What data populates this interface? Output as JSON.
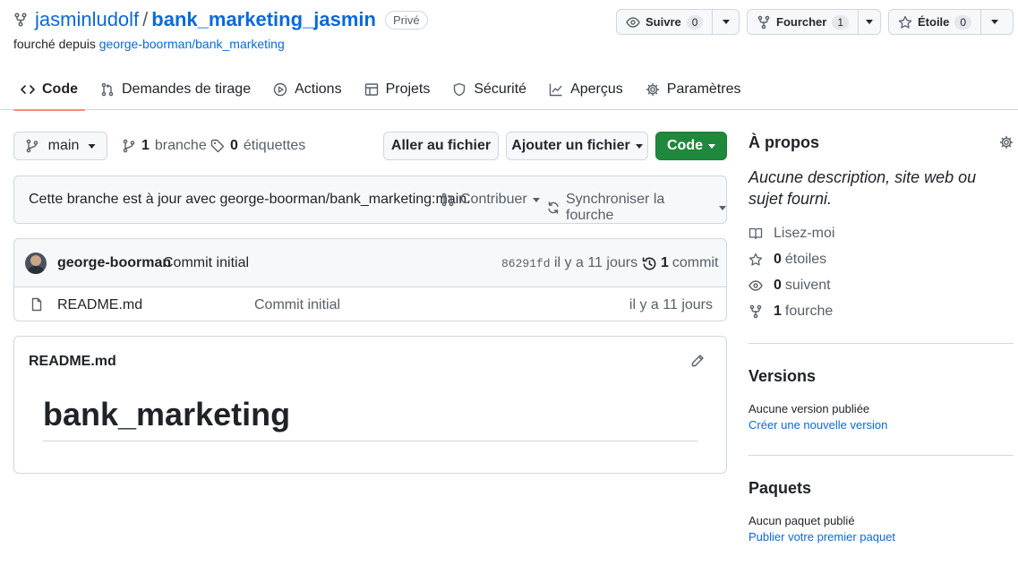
{
  "header": {
    "owner": "jasminludolf",
    "separator": "/",
    "repo": "bank_marketing_jasmin",
    "visibility": "Privé",
    "forked_prefix": "fourché depuis",
    "forked_from": "george-boorman/bank_marketing",
    "watch": {
      "label": "Suivre",
      "count": "0"
    },
    "fork": {
      "label": "Fourcher",
      "count": "1"
    },
    "star": {
      "label": "Étoile",
      "count": "0"
    }
  },
  "tabs": [
    {
      "label": "Code",
      "icon": "code-icon"
    },
    {
      "label": "Demandes de tirage",
      "icon": "pull-request-icon"
    },
    {
      "label": "Actions",
      "icon": "play-icon"
    },
    {
      "label": "Projets",
      "icon": "table-icon"
    },
    {
      "label": "Sécurité",
      "icon": "shield-icon"
    },
    {
      "label": "Aperçus",
      "icon": "graph-icon"
    },
    {
      "label": "Paramètres",
      "icon": "gear-icon"
    }
  ],
  "toolbar": {
    "branch": "main",
    "branches_count": "1",
    "branches_label": "branche",
    "tags_count": "0",
    "tags_label": "étiquettes",
    "goto_file": "Aller au fichier",
    "add_file": "Ajouter un fichier",
    "code": "Code"
  },
  "sync": {
    "message": "Cette branche est à jour avec george-boorman/bank_marketing:main.",
    "contribute": "Contribuer",
    "sync_fork": "Synchroniser la fourche"
  },
  "latest_commit": {
    "author": "george-boorman",
    "message": "Commit initial",
    "sha": "86291fd",
    "age": "il y a 11 jours",
    "commits_count": "1",
    "commits_label": "commit"
  },
  "files": [
    {
      "name": "README.md",
      "message": "Commit initial",
      "age": "il y a 11 jours"
    }
  ],
  "readme": {
    "filename": "README.md",
    "heading": "bank_marketing"
  },
  "sidebar": {
    "about_title": "À propos",
    "description": "Aucune description, site web ou sujet fourni.",
    "readme": "Lisez-moi",
    "stars_count": "0",
    "stars_label": "étoiles",
    "watchers_count": "0",
    "watchers_label": "suivent",
    "forks_count": "1",
    "forks_label": "fourche",
    "releases_title": "Versions",
    "releases_empty": "Aucune version publiée",
    "releases_link": "Créer une nouvelle version",
    "packages_title": "Paquets",
    "packages_empty": "Aucun paquet publié",
    "packages_link": "Publier votre premier paquet"
  },
  "colors": {
    "accent": "#0969da",
    "primary_button": "#1f883d",
    "tab_underline": "#fd8c73"
  }
}
